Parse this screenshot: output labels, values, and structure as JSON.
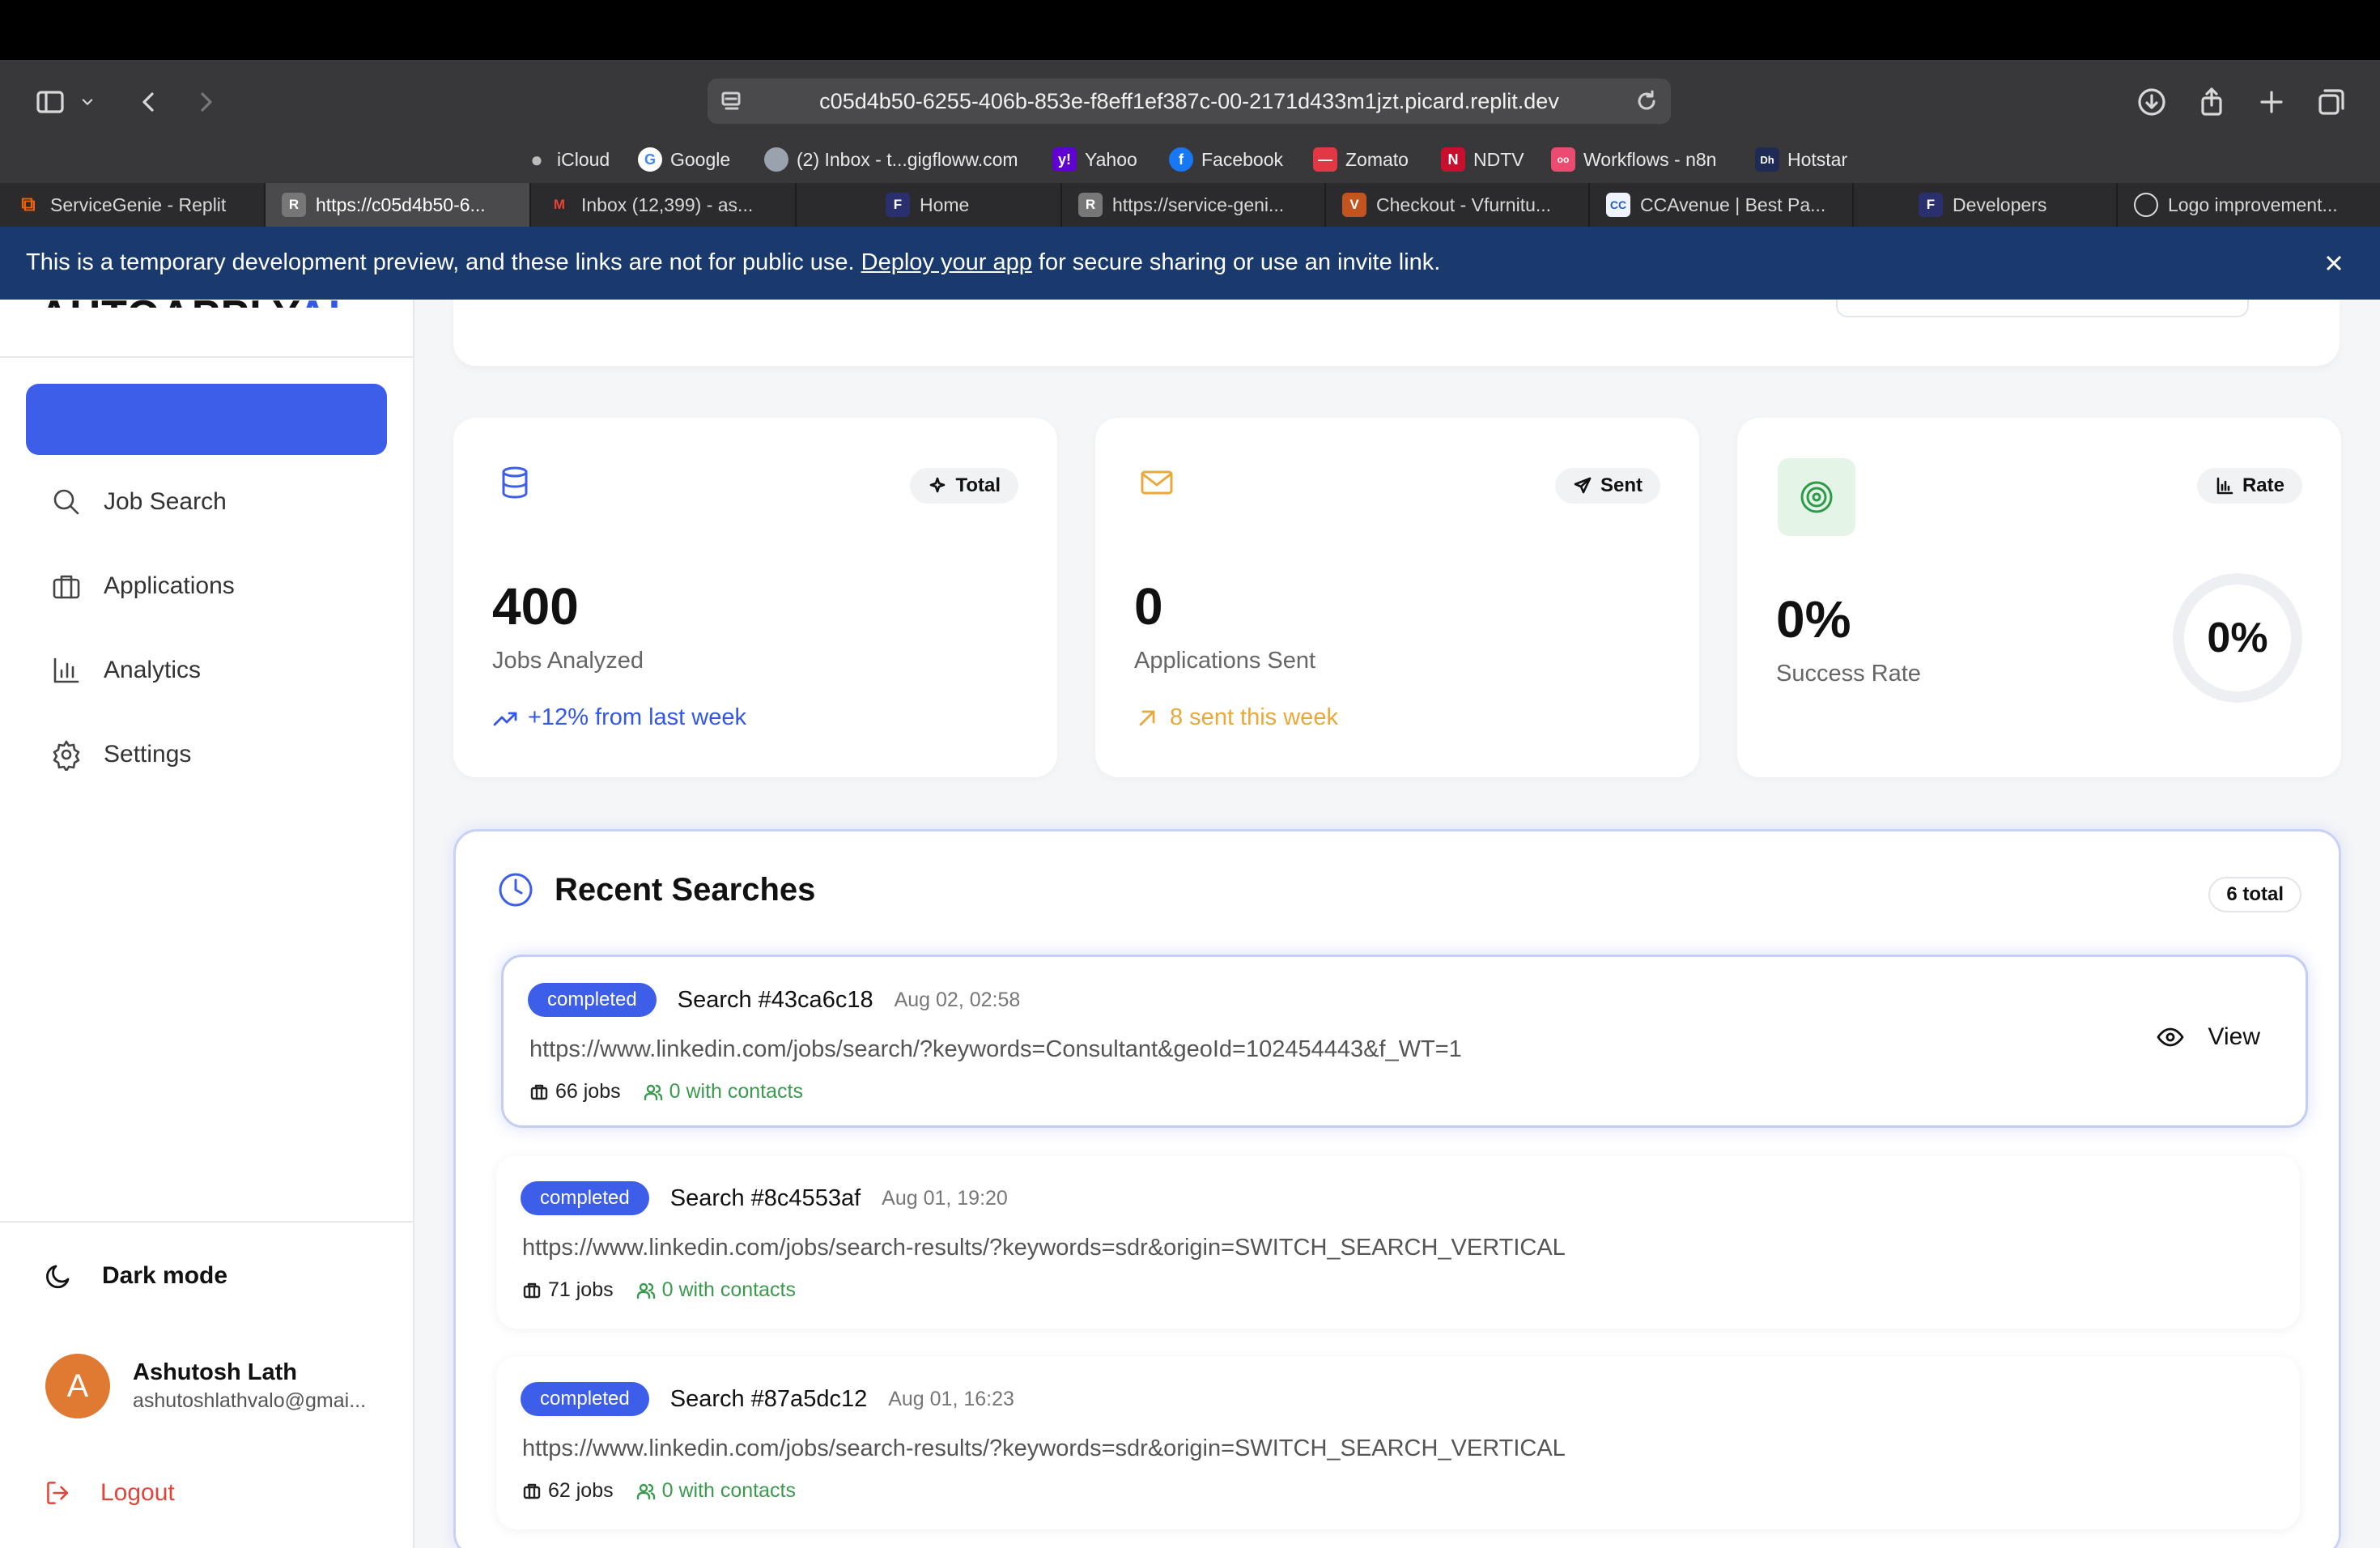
{
  "browser": {
    "url": "c05d4b50-6255-406b-853e-f8eff1ef387c-00-2171d433m1jzt.picard.replit.dev",
    "bookmarks": [
      "iCloud",
      "Google",
      "(2) Inbox - t...gigfloww.com",
      "Yahoo",
      "Facebook",
      "Zomato",
      "NDTV",
      "Workflows - n8n",
      "Hotstar"
    ],
    "tabs": [
      "ServiceGenie - Replit",
      "https://c05d4b50-6...",
      "Inbox (12,399) - as...",
      "Home",
      "https://service-geni...",
      "Checkout - Vfurnitu...",
      "CCAvenue | Best Pa...",
      "Developers",
      "Logo improvement..."
    ],
    "tab_icon_letters": [
      "",
      "R",
      "M",
      "F",
      "R",
      "",
      "CC",
      "F",
      ""
    ]
  },
  "banner": {
    "text_before": "This is a temporary development preview, and these links are not for public use. ",
    "link": "Deploy your app",
    "text_after": " for secure sharing or use an invite link."
  },
  "sidebar": {
    "brand_dark": "AUTOAPPLY",
    "brand_blue": "AI",
    "nav": [
      "Job Search",
      "Applications",
      "Analytics",
      "Settings"
    ],
    "dark_mode": "Dark mode",
    "user": {
      "initial": "A",
      "name": "Ashutosh Lath",
      "email": "ashutoshlathvalo@gmai..."
    },
    "logout": "Logout"
  },
  "stats": [
    {
      "pill": "Total",
      "value": "400",
      "label": "Jobs Analyzed",
      "trend": "+12% from last week",
      "trend_color": "#3358e8"
    },
    {
      "pill": "Sent",
      "value": "0",
      "label": "Applications Sent",
      "trend": "8 sent this week",
      "trend_color": "#e9a93a"
    },
    {
      "pill": "Rate",
      "value": "0%",
      "label": "Success Rate",
      "ring": "0%"
    }
  ],
  "recent": {
    "title": "Recent Searches",
    "total": "6 total",
    "view_label": "View",
    "items": [
      {
        "status": "completed",
        "title": "Search #43ca6c18",
        "date": "Aug 02, 02:58",
        "url": "https://www.linkedin.com/jobs/search/?keywords=Consultant&geoId=102454443&f_WT=1",
        "jobs": "66 jobs",
        "contacts": "0 with contacts"
      },
      {
        "status": "completed",
        "title": "Search #8c4553af",
        "date": "Aug 01, 19:20",
        "url": "https://www.linkedin.com/jobs/search-results/?keywords=sdr&origin=SWITCH_SEARCH_VERTICAL",
        "jobs": "71 jobs",
        "contacts": "0 with contacts"
      },
      {
        "status": "completed",
        "title": "Search #87a5dc12",
        "date": "Aug 01, 16:23",
        "url": "https://www.linkedin.com/jobs/search-results/?keywords=sdr&origin=SWITCH_SEARCH_VERTICAL",
        "jobs": "62 jobs",
        "contacts": "0 with contacts"
      }
    ]
  },
  "colors": {
    "accent": "#3d5ee8",
    "banner": "#1a3a6e",
    "danger": "#e0453a",
    "success": "#3a9a4e",
    "warning": "#e9a93a"
  }
}
